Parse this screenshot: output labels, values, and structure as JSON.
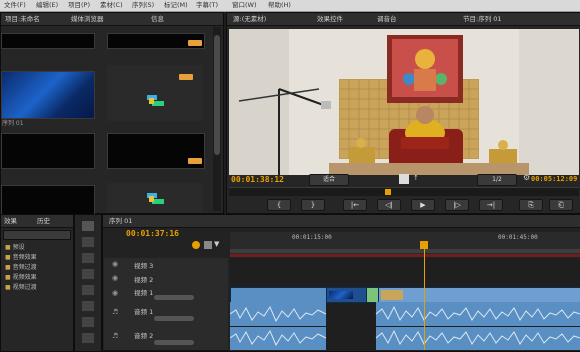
{
  "menu": [
    "文件(F)",
    "编辑(E)",
    "项目(P)",
    "素材(C)",
    "序列(S)",
    "标记(M)",
    "字幕(T)",
    "窗口(W)",
    "帮助(H)"
  ],
  "project_panel": {
    "tabs": [
      "项目:未命名",
      "媒体浏览器",
      "信息"
    ],
    "items": [
      {
        "label": "序列 01",
        "kind": "space"
      },
      {
        "label": "",
        "kind": "sequence"
      },
      {
        "label": "",
        "kind": "black"
      },
      {
        "label": "",
        "kind": "black"
      },
      {
        "label": "",
        "kind": "black"
      },
      {
        "label": "",
        "kind": "sequence"
      }
    ]
  },
  "monitor": {
    "tabs": [
      "源:(无素材)",
      "效果控件",
      "调音台",
      "节目:序列 01"
    ],
    "timecode": "00:01:38:12",
    "fit": "适合",
    "ratio": "1/2",
    "end_timecode": "00:05:12:09",
    "controls": [
      "{",
      "}",
      "|←",
      "◁|",
      "▶",
      "|▷",
      "→|",
      "⎘",
      "⎗",
      "⊡"
    ]
  },
  "left_tools": {
    "tabs": [
      "效果",
      "历史"
    ],
    "folders": [
      "预设",
      "音频效果",
      "音频过渡",
      "视频效果",
      "视频过渡"
    ]
  },
  "timeline": {
    "tab": "序列 01",
    "timecode": "00:01:37:16",
    "ruler": [
      "00:01:15:00",
      "00:01:45:00"
    ],
    "tracks": [
      {
        "name": "视频 3",
        "kind": "v"
      },
      {
        "name": "视频 2",
        "kind": "v"
      },
      {
        "name": "视频 1",
        "kind": "v"
      },
      {
        "name": "音频 1",
        "kind": "a"
      },
      {
        "name": "音频 2",
        "kind": "a"
      }
    ],
    "colors": {
      "playhead": "#e8a000",
      "video_clip": "#5a8fc4",
      "audio_clip": "#5a8fc4",
      "green_clip": "#7cc47c"
    }
  }
}
